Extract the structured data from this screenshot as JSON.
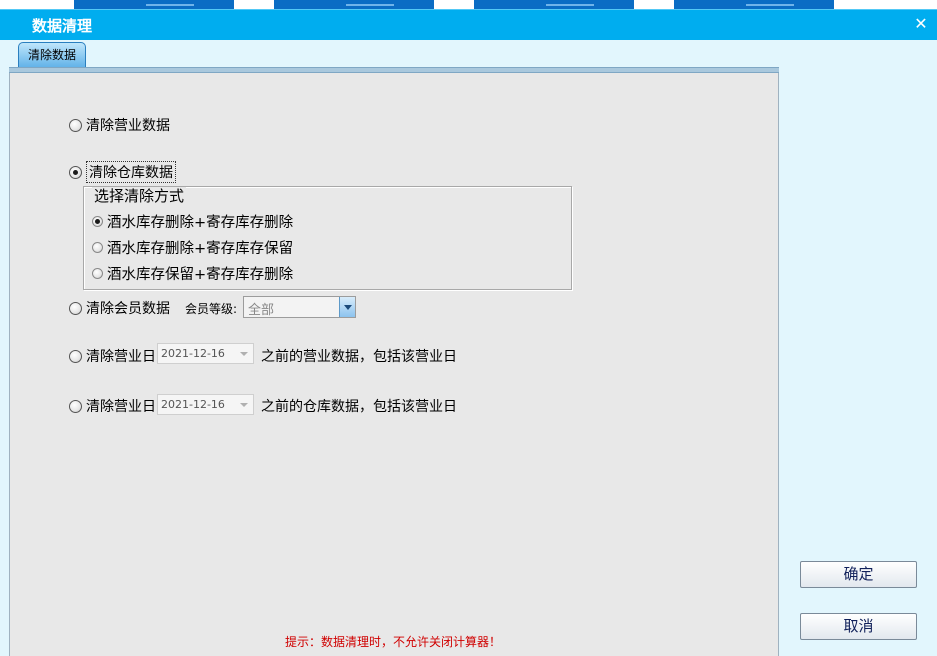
{
  "window": {
    "title": "数据清理",
    "close_icon": "close-icon"
  },
  "tabs": [
    {
      "label": "清除数据",
      "active": true
    }
  ],
  "options": {
    "business_data": {
      "label": "清除营业数据",
      "checked": false
    },
    "warehouse_data": {
      "label": "清除仓库数据",
      "checked": true
    },
    "clear_mode_group": {
      "title": "选择清除方式",
      "items": [
        {
          "label": "酒水库存删除+寄存库存删除",
          "checked": true
        },
        {
          "label": "酒水库存删除+寄存库存保留",
          "checked": false
        },
        {
          "label": "酒水库存保留+寄存库存删除",
          "checked": false
        }
      ]
    },
    "member_data": {
      "label": "清除会员数据",
      "level_label": "会员等级:",
      "level_value": "全部"
    },
    "business_day_business": {
      "label": "清除营业日",
      "date": "2021-12-16",
      "suffix": "之前的营业数据，包括该营业日"
    },
    "business_day_warehouse": {
      "label": "清除营业日",
      "date": "2021-12-16",
      "suffix": "之前的仓库数据，包括该营业日"
    }
  },
  "hint": "提示：数据清理时，不允许关闭计算器！",
  "buttons": {
    "confirm": "确定",
    "cancel": "取消"
  },
  "colors": {
    "titlebar": "#00adef",
    "window_bg": "#e2f6fd",
    "panel_bg": "#e8e8e8",
    "hint": "#d00000"
  }
}
